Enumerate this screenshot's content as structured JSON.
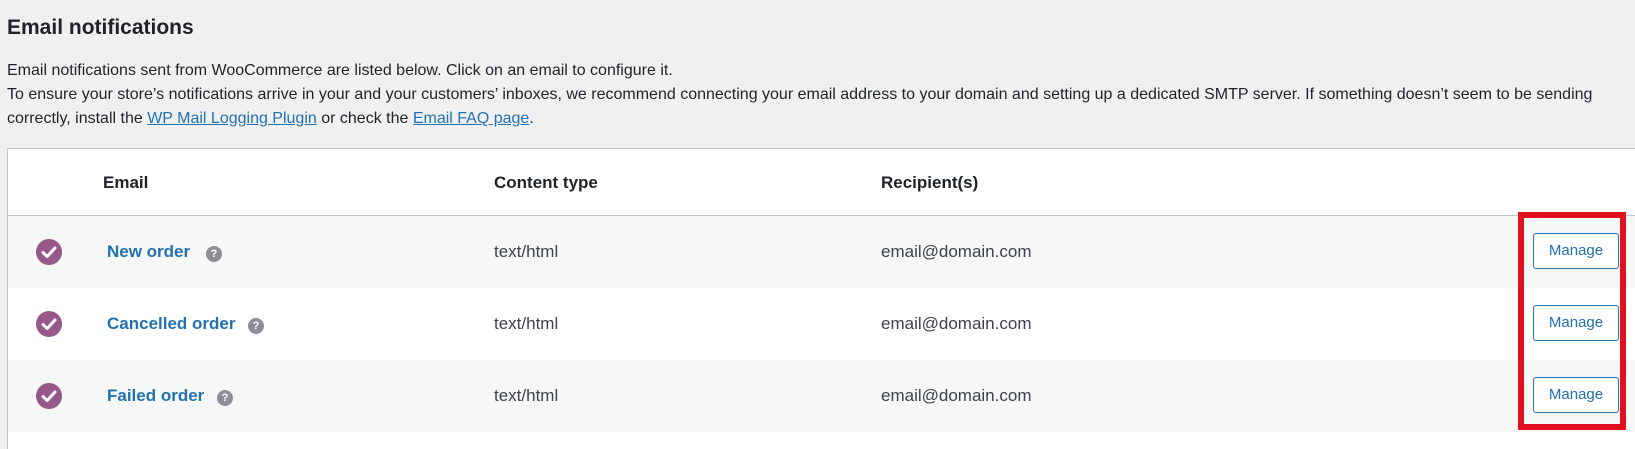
{
  "page": {
    "title": "Email notifications",
    "intro_line1": "Email notifications sent from WooCommerce are listed below. Click on an email to configure it.",
    "intro_line2_prefix": "To ensure your store’s notifications arrive in your and your customers’ inboxes, we recommend connecting your email address to your domain and setting up a dedicated SMTP server. If something doesn’t seem to be sending correctly, install the ",
    "intro_link1": "WP Mail Logging Plugin",
    "intro_middle": " or check the ",
    "intro_link2": "Email FAQ page",
    "intro_suffix": "."
  },
  "table": {
    "headers": {
      "email": "Email",
      "content_type": "Content type",
      "recipients": "Recipient(s)"
    },
    "rows": [
      {
        "name": "New order",
        "content_type": "text/html",
        "recipient": "email@domain.com",
        "enabled_icon": "check-circle-icon",
        "help_glyph": "?",
        "action": "Manage"
      },
      {
        "name": "Cancelled order",
        "content_type": "text/html",
        "recipient": "email@domain.com",
        "enabled_icon": "check-circle-icon",
        "help_glyph": "?",
        "action": "Manage"
      },
      {
        "name": "Failed order",
        "content_type": "text/html",
        "recipient": "email@domain.com",
        "enabled_icon": "check-circle-icon",
        "help_glyph": "?",
        "action": "Manage"
      }
    ]
  },
  "colors": {
    "background": "#f0f0f1",
    "link": "#2271b1",
    "enabled": "#96588a",
    "highlight": "#e0101e"
  }
}
